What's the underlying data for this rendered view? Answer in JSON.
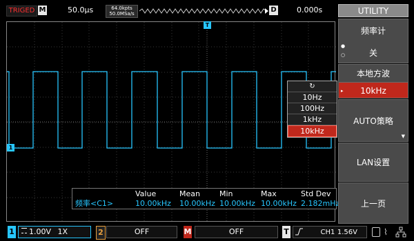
{
  "top_bar": {
    "status": "TRIGED",
    "mode_badge": "M",
    "timebase": "50.0μs",
    "mem_depth": "64.0kpts",
    "sample_rate": "50.0MSa/s",
    "delay_badge": "D",
    "delay": "0.000s"
  },
  "menu": {
    "title": "UTILITY",
    "items": [
      {
        "label": "频率计",
        "options": [
          "关"
        ]
      },
      {
        "label": "本地方波",
        "value": "10kHz"
      },
      {
        "label": "AUTO策略"
      },
      {
        "label": "LAN设置"
      },
      {
        "label": "上一页"
      }
    ]
  },
  "dropdown": {
    "reset_icon": "refresh-icon",
    "options": [
      "10Hz",
      "100Hz",
      "1kHz",
      "10kHz"
    ],
    "selected": "10kHz"
  },
  "measurement": {
    "headers": [
      "Value",
      "Mean",
      "Min",
      "Max",
      "Std Dev"
    ],
    "row_label": "频率<C1>",
    "values": [
      "10.00kHz",
      "10.00kHz",
      "10.00kHz",
      "10.00kHz",
      "2.182mHz"
    ]
  },
  "channel_marker": "1",
  "trigger_marker": "T",
  "bottom_bar": {
    "ch1_num": "1",
    "ch1_scale": "1.00V",
    "ch1_probe": "1X",
    "ch2_num": "2",
    "ch2_state": "OFF",
    "math_label": "M",
    "math_state": "OFF",
    "trigger_label": "T",
    "trigger_source": "CH1",
    "trigger_level": "1.56V"
  },
  "colors": {
    "channel1": "#27c6ff",
    "channel2": "#e8a040",
    "math": "#ff3030",
    "selected": "#c0281c"
  }
}
